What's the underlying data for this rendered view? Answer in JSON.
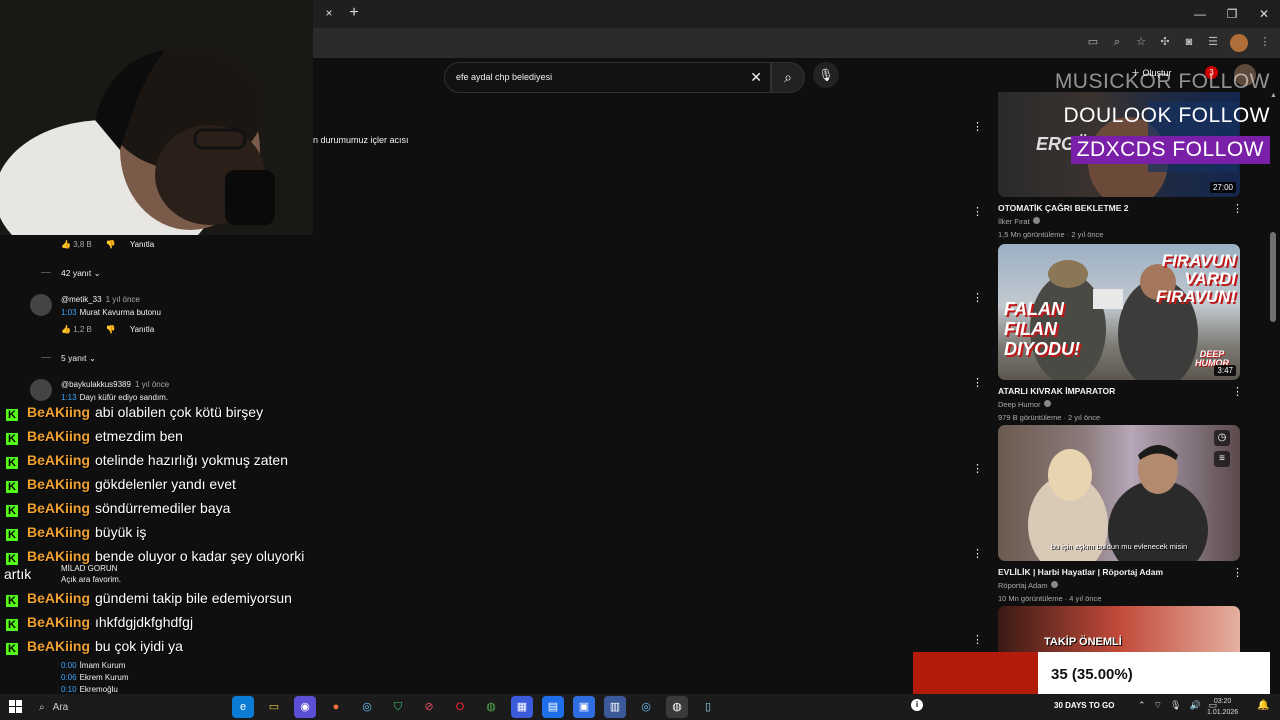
{
  "browser": {
    "tab_close": "×",
    "new_tab": "+",
    "window_controls": [
      "—",
      "❐",
      "✕"
    ]
  },
  "youtube": {
    "search_value": "efe aydal chp belediyesi",
    "create_label": "Oluştur",
    "notification_count": "3"
  },
  "comments": {
    "snippet": "n durumumuz içler acısı",
    "top_likes": "3,8 B",
    "reply_label": "Yanıtla",
    "replies_1": "42 yanıt",
    "c1_author": "@metik_33",
    "c1_time": "1 yıl önce",
    "c1_ts": "1:03",
    "c1_body": "Murat Kavurma butonu",
    "c1_likes": "1,2 B",
    "replies_2": "5 yanıt",
    "c2_author": "@baykulakkus9389",
    "c2_time": "1 yıl önce",
    "c2_ts": "1:13",
    "c2_body": "Dayı küfür ediyo sandım.",
    "c3_author": "MİLAD GORUN",
    "c3_body": "Açık ara favorim.",
    "list": [
      {
        "ts": "0:00",
        "text": "İmam Kurum"
      },
      {
        "ts": "0:06",
        "text": "Ekrem Kurum"
      },
      {
        "ts": "0:10",
        "text": "Ekremoğlu"
      }
    ]
  },
  "chat": {
    "username": "BeAKiing",
    "messages": [
      "abi olabilen çok kötü birşey",
      "etmezdim ben",
      "otelinde hazırlığı yokmuş zaten",
      "gökdelenler yandı evet",
      "söndürremediler baya",
      "büyük iş",
      "bende oluyor o kadar şey oluyorki",
      "gündemi takip bile edemiyorsun",
      "ıhkfdgjdkfghdfgj",
      "bu çok iyidi ya"
    ],
    "wrap_text": "artık"
  },
  "alerts": [
    {
      "text": "MUSICKOR  FOLLOW"
    },
    {
      "text": "DOULOOK  FOLLOW"
    },
    {
      "text": "ZDXCDS  FOLLOW"
    }
  ],
  "recommended": [
    {
      "title": "OTOMATİK ÇAĞRI BEKLETME 2",
      "channel": "İlker Fırat",
      "meta": "1,5 Mn görüntüleme · 2 yıl önce",
      "duration": "27:00",
      "thumb_text": "ERGÜN"
    },
    {
      "title": "ATARLI KIVRAK İMPARATOR",
      "channel": "Deep Humor",
      "meta": "979 B görüntüleme · 2 yıl önce",
      "duration": "3:47",
      "thumb_text_1": "FIRAVUN VARDI FIRAVUN!",
      "thumb_text_2": "FALAN FILAN DIYODU!",
      "thumb_badge": "DEEP HUMOR"
    },
    {
      "title": "EVLİLİK | Harbi Hayatlar | Röportaj Adam",
      "channel": "Röportaj Adam",
      "meta": "10 Mn görüntüleme · 4 yıl önce",
      "caption": "bu işin aşkını buldun mu evlenecek misin"
    },
    {
      "thumb_text": "TAKİP ÖNEMLİ"
    }
  ],
  "goal": {
    "label": "35 (35.00%)",
    "value": 35,
    "max": 100,
    "fill_fraction": 0.35,
    "fill_color": "#b31b0c"
  },
  "taskbar": {
    "search_label": "Ara",
    "goal_text": "30 DAYS TO GO",
    "time": "03:20",
    "date": "1.01.2026"
  }
}
